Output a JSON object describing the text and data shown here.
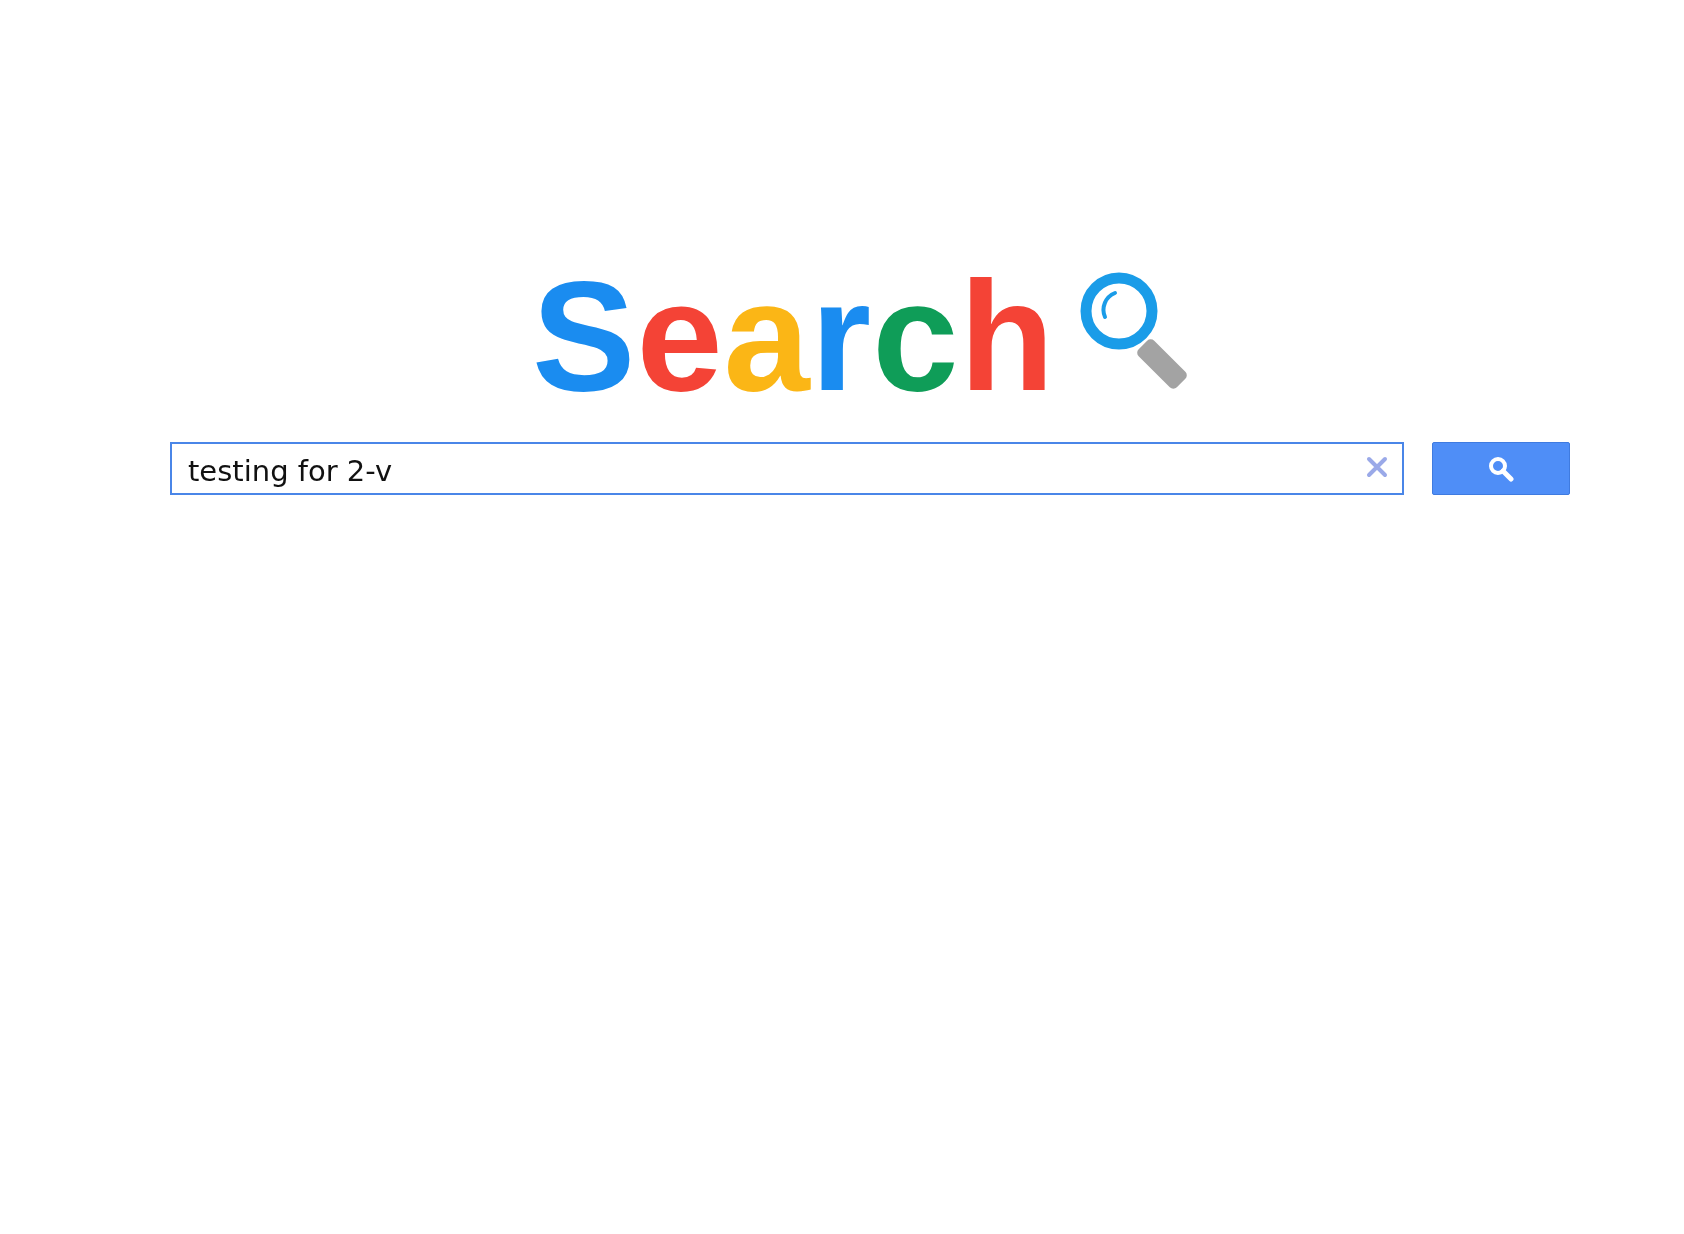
{
  "logo": {
    "letters": [
      {
        "char": "S",
        "color": "#1a8cf0"
      },
      {
        "char": "e",
        "color": "#f44336"
      },
      {
        "char": "a",
        "color": "#fbb616"
      },
      {
        "char": "r",
        "color": "#1a8cf0"
      },
      {
        "char": "c",
        "color": "#0f9d58"
      },
      {
        "char": "h",
        "color": "#f44336"
      }
    ]
  },
  "search": {
    "value": "testing for 2-v"
  }
}
